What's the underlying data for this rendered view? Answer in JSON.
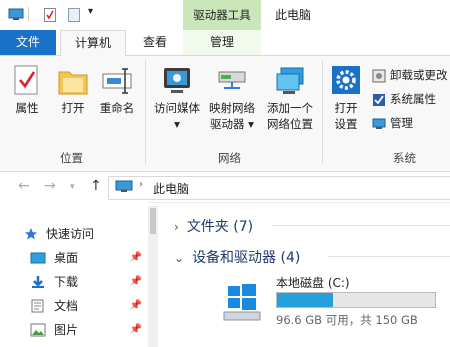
{
  "title_bar": {
    "context_tab": "驱动器工具",
    "window_title": "此电脑"
  },
  "tabs": {
    "file": "文件",
    "computer": "计算机",
    "view": "查看",
    "manage": "管理"
  },
  "ribbon": {
    "location_group": {
      "label": "位置",
      "properties": "属性",
      "open": "打开",
      "rename": "重命名"
    },
    "network_group": {
      "label": "网络",
      "access_media": [
        "访问媒体",
        "▾"
      ],
      "map_drive": [
        "映射网络",
        "驱动器 ▾"
      ],
      "add_location": [
        "添加一个",
        "网络位置"
      ]
    },
    "system_group": {
      "label": "系统",
      "open_settings": [
        "打开",
        "设置"
      ],
      "uninstall": "卸载或更改",
      "system_properties": "系统属性",
      "manage": "管理"
    }
  },
  "address": {
    "path": "此电脑"
  },
  "nav_pane": {
    "quick_access": "快速访问",
    "items": [
      "桌面",
      "下载",
      "文档",
      "图片"
    ]
  },
  "content": {
    "folders_header": "文件夹 (7)",
    "devices_header": "设备和驱动器 (4)",
    "drive": {
      "name": "本地磁盘 (C:)",
      "usage_text": "96.6 GB 可用，共 150 GB",
      "used_fraction": 0.356
    }
  },
  "colors": {
    "accent": "#1a71c8",
    "context_tab": "#c9e7b8",
    "drive_bar": "#26a0da"
  }
}
